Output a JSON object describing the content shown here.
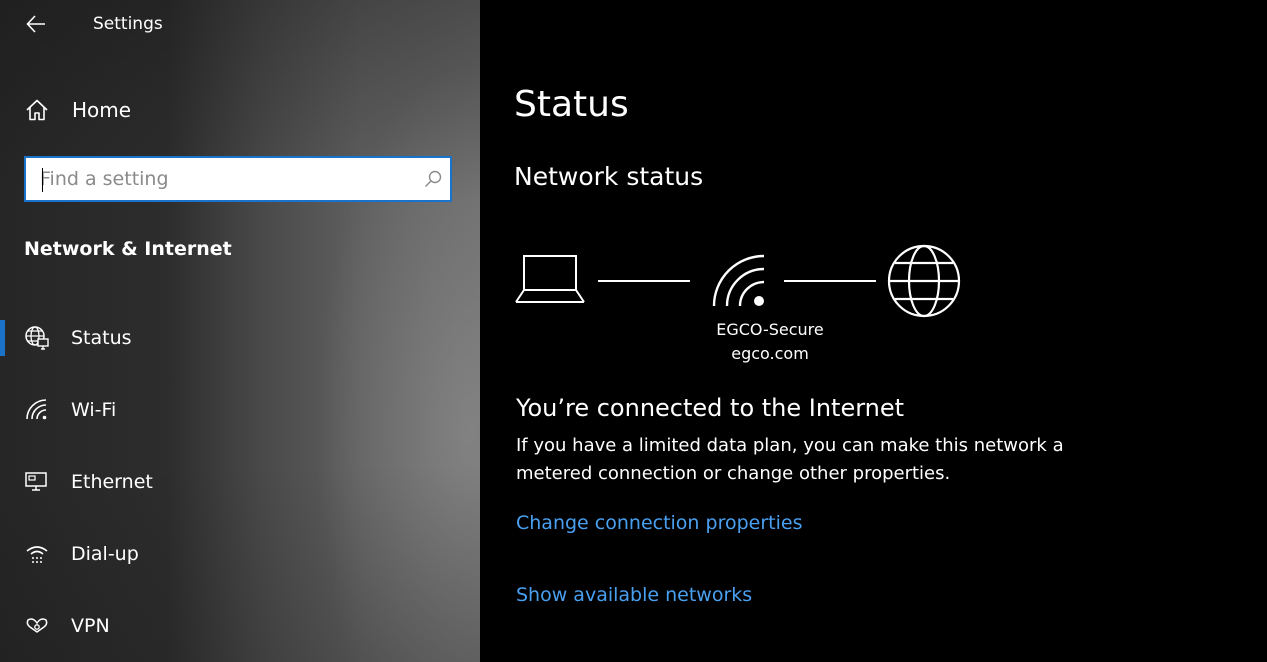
{
  "window": {
    "title": "Settings"
  },
  "sidebar": {
    "home_label": "Home",
    "search": {
      "placeholder": "Find a setting",
      "value": ""
    },
    "section_title": "Network & Internet",
    "items": [
      {
        "label": "Status",
        "icon": "globe-monitor-icon",
        "active": true
      },
      {
        "label": "Wi-Fi",
        "icon": "wifi-icon",
        "active": false
      },
      {
        "label": "Ethernet",
        "icon": "ethernet-icon",
        "active": false
      },
      {
        "label": "Dial-up",
        "icon": "dialup-icon",
        "active": false
      },
      {
        "label": "VPN",
        "icon": "vpn-icon",
        "active": false
      }
    ]
  },
  "main": {
    "title": "Status",
    "subheading": "Network status",
    "network": {
      "ssid": "EGCO-Secure",
      "domain": "egco.com"
    },
    "connected_heading": "You’re connected to the Internet",
    "description": "If you have a limited data plan, you can make this network a metered connection or change other properties.",
    "links": {
      "change_properties": "Change connection properties",
      "show_networks": "Show available networks"
    }
  },
  "colors": {
    "accent": "#1a73c9",
    "link": "#4aa0f0",
    "background": "#000000"
  }
}
